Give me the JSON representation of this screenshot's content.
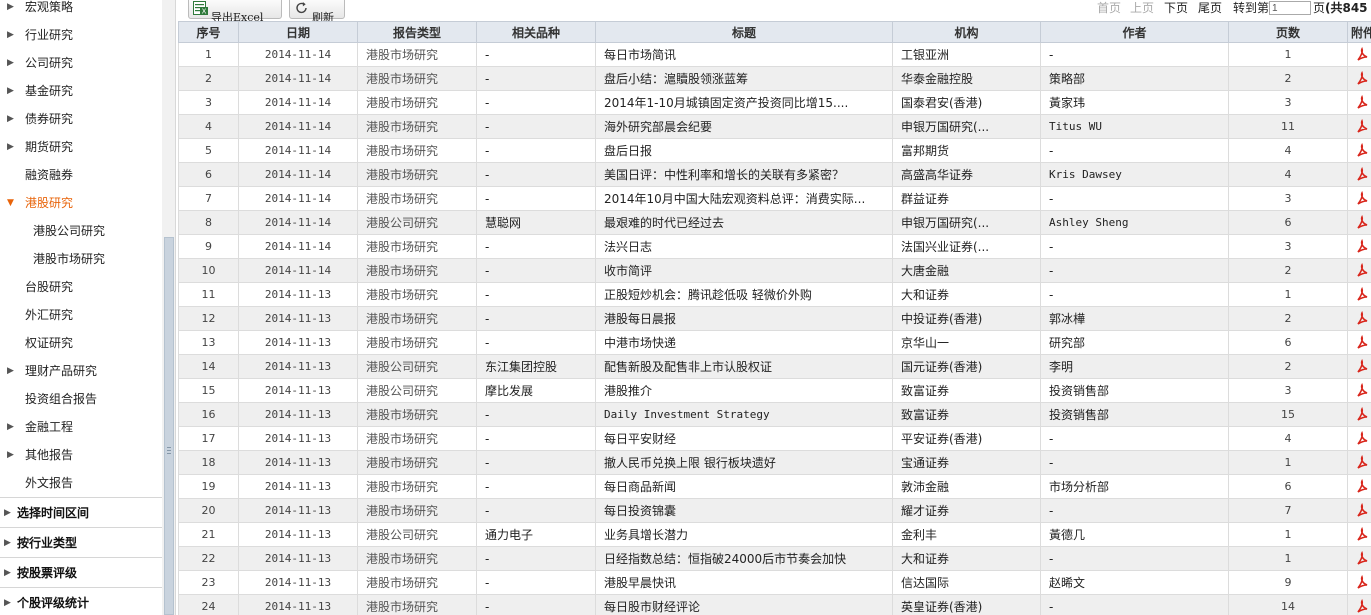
{
  "sidebar": {
    "items": [
      {
        "label": "宏观策略",
        "expandable": true,
        "sub": false,
        "active": false
      },
      {
        "label": "行业研究",
        "expandable": true,
        "sub": false,
        "active": false
      },
      {
        "label": "公司研究",
        "expandable": true,
        "sub": false,
        "active": false
      },
      {
        "label": "基金研究",
        "expandable": true,
        "sub": false,
        "active": false
      },
      {
        "label": "债券研究",
        "expandable": true,
        "sub": false,
        "active": false
      },
      {
        "label": "期货研究",
        "expandable": true,
        "sub": false,
        "active": false
      },
      {
        "label": "融资融券",
        "expandable": false,
        "sub": false,
        "active": false
      },
      {
        "label": "港股研究",
        "expandable": true,
        "expanded": true,
        "sub": false,
        "active": true
      },
      {
        "label": "港股公司研究",
        "expandable": false,
        "sub": true,
        "active": false
      },
      {
        "label": "港股市场研究",
        "expandable": false,
        "sub": true,
        "active": false
      },
      {
        "label": "台股研究",
        "expandable": false,
        "sub": false,
        "active": false
      },
      {
        "label": "外汇研究",
        "expandable": false,
        "sub": false,
        "active": false
      },
      {
        "label": "权证研究",
        "expandable": false,
        "sub": false,
        "active": false
      },
      {
        "label": "理财产品研究",
        "expandable": true,
        "sub": false,
        "active": false
      },
      {
        "label": "投资组合报告",
        "expandable": false,
        "sub": false,
        "active": false
      },
      {
        "label": "金融工程",
        "expandable": true,
        "sub": false,
        "active": false
      },
      {
        "label": "其他报告",
        "expandable": true,
        "sub": false,
        "active": false
      },
      {
        "label": "外文报告",
        "expandable": false,
        "sub": false,
        "active": false
      }
    ],
    "filters": [
      "选择时间区间",
      "按行业类型",
      "按股票评级",
      "个股评级统计"
    ]
  },
  "toolbar": {
    "export_label": "导出Excel",
    "refresh_label": "刷新"
  },
  "pager": {
    "first": "首页",
    "prev": "上页",
    "next": "下页",
    "last": "尾页",
    "goto_prefix": "转到第",
    "goto_value": "1",
    "page_suffix": "页",
    "total": "(共845"
  },
  "table": {
    "headers": [
      "序号",
      "日期",
      "报告类型",
      "相关品种",
      "标题",
      "机构",
      "作者",
      "页数",
      "附件"
    ],
    "rows": [
      [
        "1",
        "2014-11-14",
        "港股市场研究",
        "-",
        "每日市场简讯",
        "工银亚洲",
        "-",
        "1"
      ],
      [
        "2",
        "2014-11-14",
        "港股市场研究",
        "-",
        "盘后小结：滬贖股领涨蓝筹",
        "华泰金融控股",
        "策略部",
        "2"
      ],
      [
        "3",
        "2014-11-14",
        "港股市场研究",
        "-",
        "2014年1-10月城镇固定资产投资同比增15....",
        "国泰君安(香港)",
        "黃家玮",
        "3"
      ],
      [
        "4",
        "2014-11-14",
        "港股市场研究",
        "-",
        "海外研究部晨会纪要",
        "申银万国研究(...",
        "Titus WU",
        "11"
      ],
      [
        "5",
        "2014-11-14",
        "港股市场研究",
        "-",
        "盘后日报",
        "富邦期货",
        "-",
        "4"
      ],
      [
        "6",
        "2014-11-14",
        "港股市场研究",
        "-",
        "美国日评：中性利率和增长的关联有多紧密？",
        "高盛高华证券",
        "Kris Dawsey",
        "4"
      ],
      [
        "7",
        "2014-11-14",
        "港股市场研究",
        "-",
        "2014年10月中国大陆宏观资料总评：消费实际...",
        "群益证券",
        "-",
        "3"
      ],
      [
        "8",
        "2014-11-14",
        "港股公司研究",
        "慧聪网",
        "最艰难的时代已经过去",
        "申银万国研究(...",
        "Ashley Sheng",
        "6"
      ],
      [
        "9",
        "2014-11-14",
        "港股市场研究",
        "-",
        "法兴日志",
        "法国兴业证券(...",
        "-",
        "3"
      ],
      [
        "10",
        "2014-11-14",
        "港股市场研究",
        "-",
        "收市简评",
        "大唐金融",
        "-",
        "2"
      ],
      [
        "11",
        "2014-11-13",
        "港股市场研究",
        "-",
        "正股短炒机会：腾讯趁低吸 轻微价外购",
        "大和证券",
        "-",
        "1"
      ],
      [
        "12",
        "2014-11-13",
        "港股市场研究",
        "-",
        "港股每日晨报",
        "中投证券(香港)",
        "郭冰樺",
        "2"
      ],
      [
        "13",
        "2014-11-13",
        "港股市场研究",
        "-",
        "中港市场快递",
        "京华山一",
        "研究部",
        "6"
      ],
      [
        "14",
        "2014-11-13",
        "港股公司研究",
        "东江集团控股",
        "配售新股及配售非上市认股权证",
        "国元证券(香港)",
        "李明",
        "2"
      ],
      [
        "15",
        "2014-11-13",
        "港股公司研究",
        "摩比发展",
        "港股推介",
        "致富证券",
        "投资销售部",
        "3"
      ],
      [
        "16",
        "2014-11-13",
        "港股市场研究",
        "-",
        "Daily Investment Strategy",
        "致富证券",
        "投资销售部",
        "15"
      ],
      [
        "17",
        "2014-11-13",
        "港股市场研究",
        "-",
        "每日平安财经",
        "平安证券(香港)",
        "-",
        "4"
      ],
      [
        "18",
        "2014-11-13",
        "港股市场研究",
        "-",
        "撤人民币兑换上限 银行板块遗好",
        "宝通证券",
        "-",
        "1"
      ],
      [
        "19",
        "2014-11-13",
        "港股市场研究",
        "-",
        "每日商品新闻",
        "敦沛金融",
        "市场分析部",
        "6"
      ],
      [
        "20",
        "2014-11-13",
        "港股市场研究",
        "-",
        "每日投资锦囊",
        "耀才证券",
        "-",
        "7"
      ],
      [
        "21",
        "2014-11-13",
        "港股公司研究",
        "通力电子",
        "业务具增长潜力",
        "金利丰",
        "黃德几",
        "1"
      ],
      [
        "22",
        "2014-11-13",
        "港股市场研究",
        "-",
        "日经指数总结：恒指破24000后市节奏会加快",
        "大和证券",
        "-",
        "1"
      ],
      [
        "23",
        "2014-11-13",
        "港股市场研究",
        "-",
        "港股早晨快讯",
        "信达国际",
        "赵晞文",
        "9"
      ],
      [
        "24",
        "2014-11-13",
        "港股市场研究",
        "-",
        "每日股市财经评论",
        "英皇证券(香港)",
        "-",
        "14"
      ]
    ]
  },
  "colors": {
    "active": "#e8640a",
    "header_bg": "#e3e8ef",
    "stripe": "#efefef",
    "pdf": "#d9261c"
  },
  "icons": {
    "export": "excel-icon",
    "refresh": "refresh-icon",
    "attachment": "pdf-icon"
  }
}
